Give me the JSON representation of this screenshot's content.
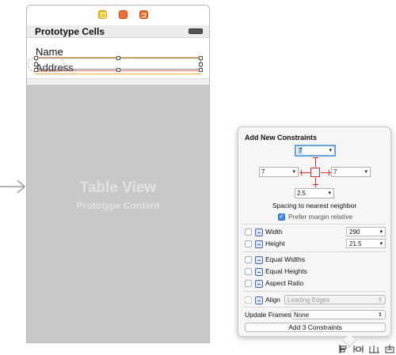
{
  "scene": {
    "prototype_header": "Prototype Cells",
    "cell": {
      "name_label": "Name",
      "address_label": "Address"
    },
    "table_view": {
      "title": "Table View",
      "subtitle": "Prototype Content"
    }
  },
  "popover": {
    "title": "Add New Constraints",
    "spacing": {
      "top": "7",
      "left": "7",
      "right": "7",
      "bottom": "2.5"
    },
    "spacing_caption": "Spacing to nearest neighbor",
    "prefer_margin": {
      "label": "Prefer margin relative",
      "checked": true
    },
    "width": {
      "label": "Width",
      "value": "290"
    },
    "height": {
      "label": "Height",
      "value": "21.5"
    },
    "equal_widths": "Equal Widths",
    "equal_heights": "Equal Heights",
    "aspect_ratio": "Aspect Ratio",
    "align": {
      "label": "Align",
      "value": "Leading Edges"
    },
    "update_frames": {
      "label": "Update Frames",
      "value": "None"
    },
    "add_button": "Add 3 Constraints"
  },
  "icons": [
    "view-controller-icon",
    "first-responder-icon",
    "exit-icon",
    "align-icon",
    "pin-icon",
    "resolve-icon",
    "resizing-icon"
  ],
  "colors": {
    "selection_blue": "#3f8ce8",
    "constraint_red": "#dd3333",
    "guide_orange": "#f3b24a",
    "table_gray": "#c8c8c8"
  }
}
